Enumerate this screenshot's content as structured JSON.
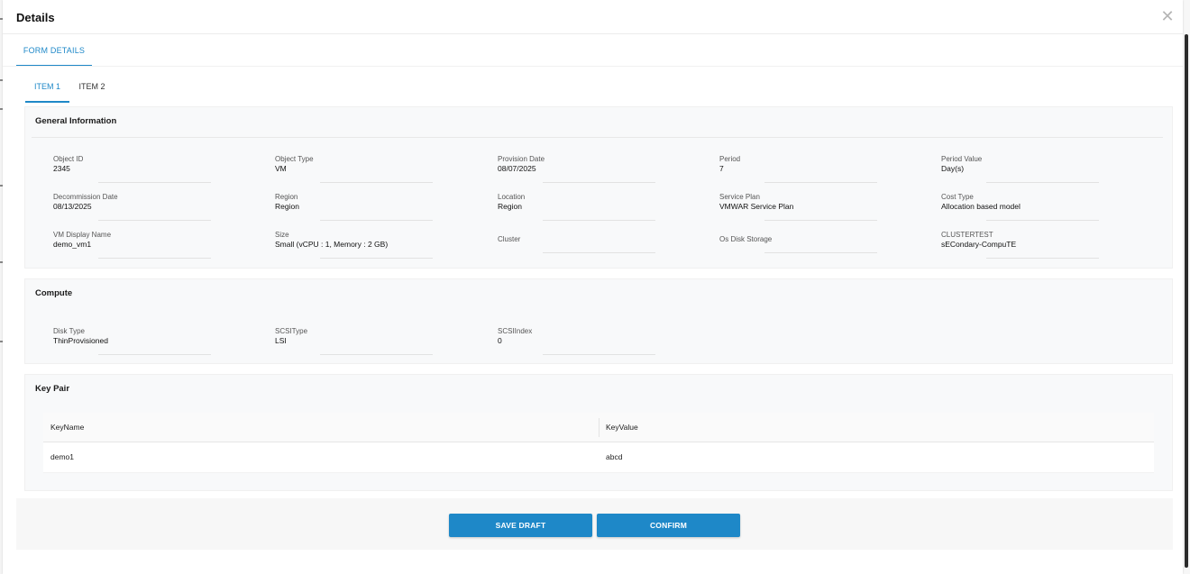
{
  "modal": {
    "title": "Details",
    "close_glyph": "✕"
  },
  "top_tabs": [
    {
      "label": "FORM DETAILS",
      "active": true
    }
  ],
  "item_tabs": [
    {
      "label": "ITEM 1",
      "active": true
    },
    {
      "label": "ITEM 2",
      "active": false
    }
  ],
  "general": {
    "title": "General Information",
    "fields": [
      {
        "label": "Object ID",
        "value": "2345"
      },
      {
        "label": "Object Type",
        "value": "VM"
      },
      {
        "label": "Provision Date",
        "value": "08/07/2025"
      },
      {
        "label": "Period",
        "value": "7"
      },
      {
        "label": "Period Value",
        "value": "Day(s)"
      },
      {
        "label": "Decommission Date",
        "value": "08/13/2025"
      },
      {
        "label": "Region",
        "value": "Region"
      },
      {
        "label": "Location",
        "value": "Region"
      },
      {
        "label": "Service Plan",
        "value": "VMWAR Service Plan"
      },
      {
        "label": "Cost Type",
        "value": "Allocation based model"
      },
      {
        "label": "VM Display Name",
        "value": "demo_vm1"
      },
      {
        "label": "Size",
        "value": "Small (vCPU : 1, Memory : 2 GB)"
      },
      {
        "label": "Cluster",
        "value": ""
      },
      {
        "label": "Os Disk Storage",
        "value": ""
      },
      {
        "label": "CLUSTERTEST",
        "value": "sECondary-CompuTE"
      }
    ]
  },
  "compute": {
    "title": "Compute",
    "fields": [
      {
        "label": "Disk Type",
        "value": "ThinProvisioned"
      },
      {
        "label": "SCSIType",
        "value": "LSI"
      },
      {
        "label": "SCSIIndex",
        "value": "0"
      }
    ]
  },
  "keypair": {
    "title": "Key Pair",
    "columns": [
      "KeyName",
      "KeyValue"
    ],
    "rows": [
      [
        "demo1",
        "abcd"
      ]
    ]
  },
  "footer": {
    "save_label": "SAVE DRAFT",
    "confirm_label": "CONFIRM"
  },
  "colors": {
    "accent": "#1e88c8",
    "section_bg": "#f8f9fa"
  }
}
